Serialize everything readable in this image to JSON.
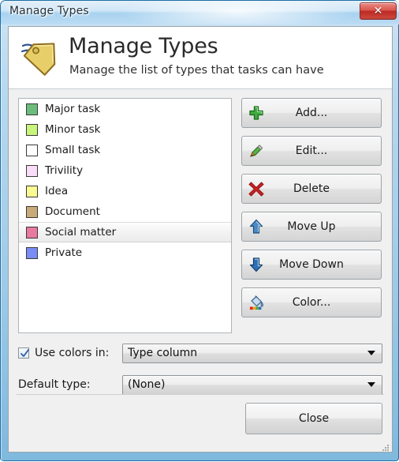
{
  "window": {
    "title": "Manage Types",
    "close_button_glyph": "✕",
    "accent_title_color": "#b9d9ef",
    "close_button_color": "#c2372d"
  },
  "header": {
    "title": "Manage Types",
    "subtitle": "Manage the list of types that tasks can have",
    "icon": "tag-icon"
  },
  "list": {
    "items": [
      {
        "label": "Major task",
        "color": "#6cbd7c",
        "selected": false
      },
      {
        "label": "Minor task",
        "color": "#c8f57c",
        "selected": false
      },
      {
        "label": "Small task",
        "color": "#ffffff",
        "selected": false
      },
      {
        "label": "Trivility",
        "color": "#f9dcf7",
        "selected": false
      },
      {
        "label": "Idea",
        "color": "#fafa92",
        "selected": false
      },
      {
        "label": "Document",
        "color": "#c9ab79",
        "selected": false
      },
      {
        "label": "Social matter",
        "color": "#e8799f",
        "selected": true
      },
      {
        "label": "Private",
        "color": "#7a8cf5",
        "selected": false
      }
    ]
  },
  "buttons": [
    {
      "label": "Add...",
      "icon": "plus-icon"
    },
    {
      "label": "Edit...",
      "icon": "pencil-icon"
    },
    {
      "label": "Delete",
      "icon": "delete-x-icon"
    },
    {
      "label": "Move Up",
      "icon": "arrow-up-icon"
    },
    {
      "label": "Move Down",
      "icon": "arrow-down-icon"
    },
    {
      "label": "Color...",
      "icon": "paint-bucket-icon"
    }
  ],
  "options": {
    "use_colors_label": "Use colors in:",
    "use_colors_checked": true,
    "use_colors_value": "Type column",
    "default_type_label": "Default type:",
    "default_type_value": "(None)"
  },
  "footer": {
    "close_label": "Close"
  }
}
